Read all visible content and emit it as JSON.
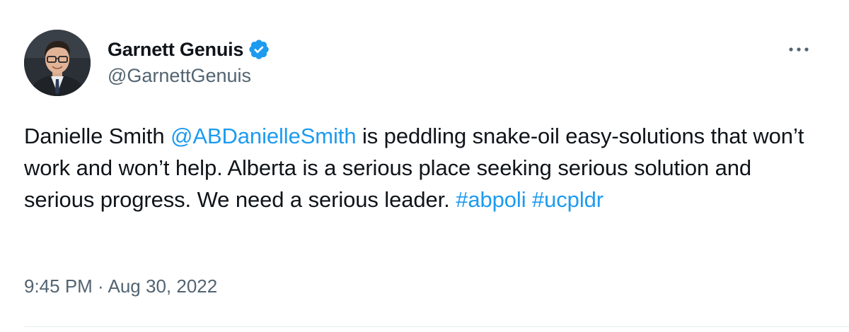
{
  "author": {
    "display_name": "Garnett Genuis",
    "handle": "@GarnettGenuis",
    "verified_icon": "verified-badge-icon",
    "avatar_icon": "profile-photo"
  },
  "actions": {
    "more_icon": "more-options-icon"
  },
  "tweet": {
    "segments": {
      "t1": "Danielle Smith ",
      "mention": "@ABDanielleSmith",
      "t2": " is peddling snake-oil easy-solutions that won’t work and won’t help. Alberta is a serious place seeking serious solution and serious progress. We need a serious leader. ",
      "hashtag1": "#abpoli",
      "t3": " ",
      "hashtag2": "#ucpldr"
    }
  },
  "meta": {
    "time": "9:45 PM",
    "separator": " · ",
    "date": "Aug 30, 2022"
  },
  "colors": {
    "link": "#1d9bf0",
    "secondary_text": "#536471",
    "primary_text": "#0f1419",
    "verified": "#1d9bf0"
  }
}
